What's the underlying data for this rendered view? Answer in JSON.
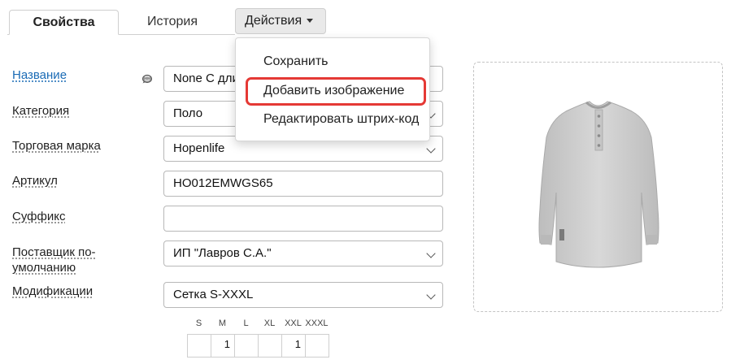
{
  "tabs": {
    "properties": "Свойства",
    "history": "История",
    "actions": "Действия"
  },
  "menu": {
    "items": [
      "Сохранить",
      "Добавить изображение",
      "Редактировать штрих-код"
    ],
    "highlighted_index": 1,
    "highlight_color": "#e53935"
  },
  "form": {
    "name": {
      "label": "Название",
      "value": "None C длин"
    },
    "category": {
      "label": "Категория",
      "value": "Поло"
    },
    "brand": {
      "label": "Торговая марка",
      "value": "Hopenlife"
    },
    "sku": {
      "label": "Артикул",
      "value": "HO012EMWGS65"
    },
    "suffix": {
      "label": "Суффикс",
      "value": ""
    },
    "supplier": {
      "label_line1": "Поставщик по-",
      "label_line2": "умолчанию",
      "value": "ИП \"Лавров С.А.\""
    },
    "modifications": {
      "label": "Модификации",
      "value": "Сетка S-XXXL"
    }
  },
  "sizes": {
    "headers": [
      "S",
      "M",
      "L",
      "XL",
      "XXL",
      "XXXL"
    ],
    "values": [
      "",
      "1",
      "",
      "",
      "1",
      ""
    ]
  },
  "colors": {
    "link": "#1a6bb5",
    "shirt": "#cfcfcf"
  }
}
